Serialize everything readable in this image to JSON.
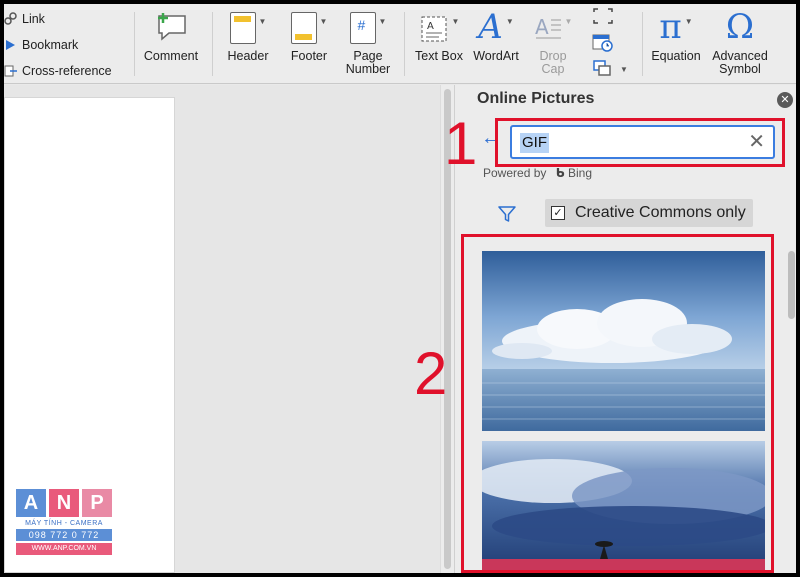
{
  "ribbon": {
    "links": [
      {
        "label": "Link",
        "icon": "link-icon"
      },
      {
        "label": "Bookmark",
        "icon": "bookmark-icon"
      },
      {
        "label": "Cross-reference",
        "icon": "cross-reference-icon"
      }
    ],
    "comment_label": "Comment",
    "header_label": "Header",
    "footer_label": "Footer",
    "page_number_label": "Page\nNumber",
    "text_box_label": "Text Box",
    "wordart_label": "WordArt",
    "drop_cap_label": "Drop\nCap",
    "equation_label": "Equation",
    "equation_glyph": "π",
    "advanced_symbol_label": "Advanced\nSymbol",
    "advanced_symbol_glyph": "Ω",
    "wordart_glyph": "A",
    "page_number_glyph": "#"
  },
  "pane": {
    "title": "Online Pictures",
    "close_glyph": "✕",
    "back_glyph": "←",
    "search_value": "GIF",
    "clear_glyph": "✕",
    "powered_by": "Powered by",
    "bing_label": "Bing",
    "filter_checkbox_label": "Creative Commons only",
    "filter_checked": true,
    "check_glyph": "✓"
  },
  "annotations": {
    "one": "1",
    "two": "2"
  },
  "watermark": {
    "letters": [
      "A",
      "N",
      "P"
    ],
    "tagline": "MÁY TÍNH - CAMERA",
    "phone": "098 772 0 772",
    "site": "WWW.ANP.COM.VN"
  },
  "colors": {
    "accent": "#2b6fd0",
    "annotation_red": "#e0112b"
  }
}
